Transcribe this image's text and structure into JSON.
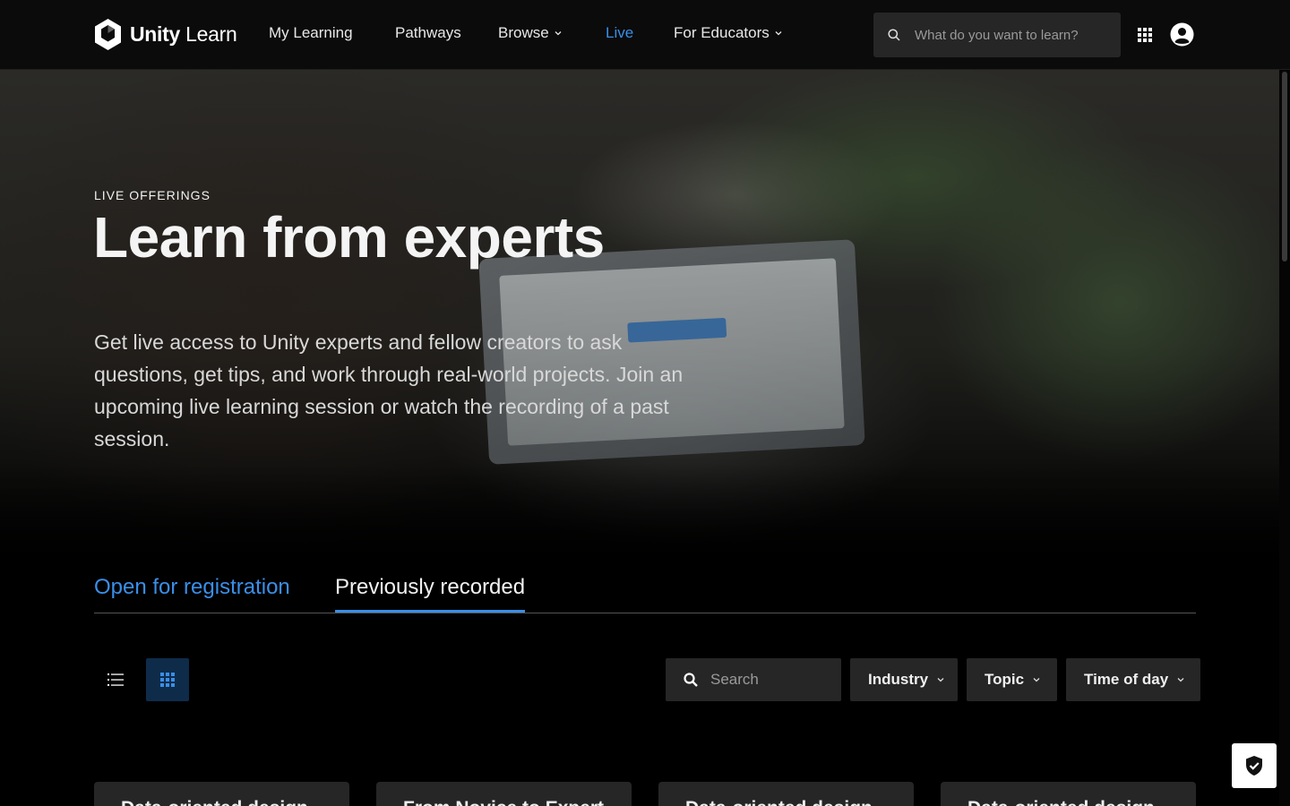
{
  "nav": {
    "logo_bold": "Unity",
    "logo_light": "Learn",
    "links": [
      {
        "label": "My Learning"
      },
      {
        "label": "Pathways"
      },
      {
        "label": "Browse"
      },
      {
        "label": "Live"
      },
      {
        "label": "For Educators"
      }
    ],
    "active_link": "Live",
    "search_placeholder": "What do you want to learn?",
    "icons": [
      "search-icon",
      "apps-grid-icon",
      "user-account-icon"
    ]
  },
  "hero": {
    "eyebrow": "LIVE OFFERINGS",
    "title": "Learn from experts",
    "description": "Get live access to Unity experts and fellow creators to ask questions, get tips, and work through real-world projects. Join an upcoming live learning session or watch the recording of a past session."
  },
  "tabs": [
    {
      "label": "Open for registration"
    },
    {
      "label": "Previously recorded"
    }
  ],
  "selected_tab": "Previously recorded",
  "toolbar": {
    "view_modes": [
      "list-view-icon",
      "grid-view-icon"
    ],
    "selected_view": "grid",
    "search_placeholder": "Search",
    "filters": [
      {
        "label": "Industry"
      },
      {
        "label": "Topic"
      },
      {
        "label": "Time of day"
      }
    ]
  },
  "cards": [
    {
      "title": "Data-oriented design"
    },
    {
      "title": "From Novice to Expert"
    },
    {
      "title": "Data-oriented design"
    },
    {
      "title": "Data-oriented design"
    }
  ],
  "colors": {
    "accent": "#3a8fe8",
    "nav_bg": "#0b0b0b",
    "control_bg": "#262626",
    "grid_view_bg": "#0e2c4a"
  }
}
